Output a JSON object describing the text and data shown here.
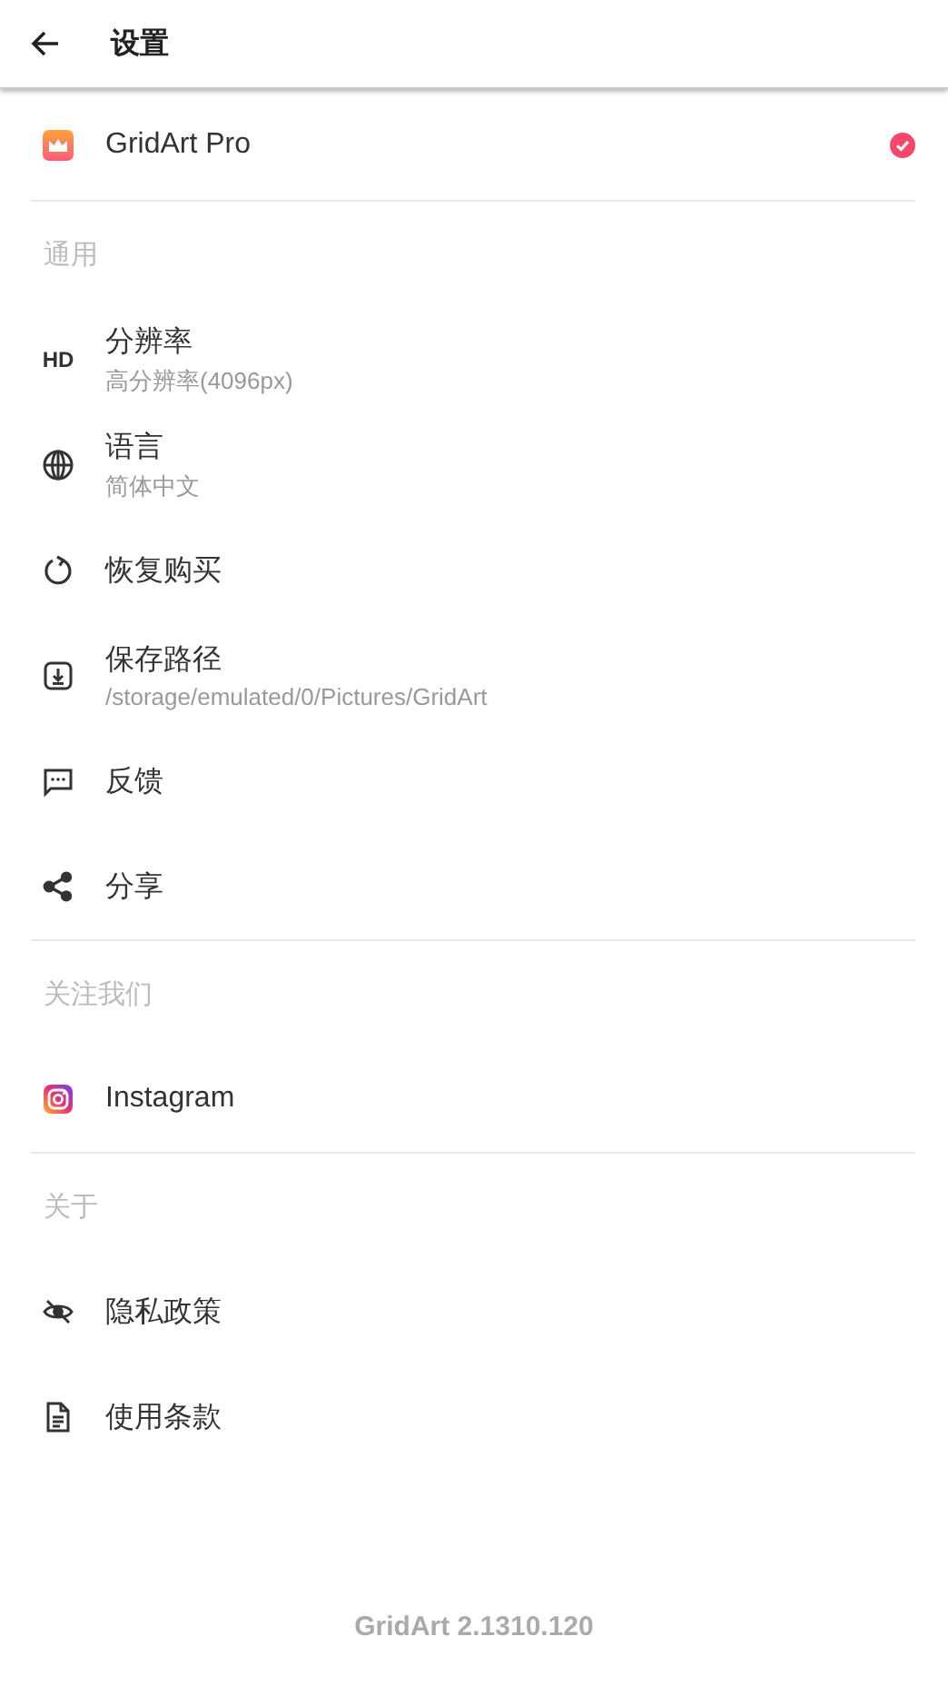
{
  "app_bar": {
    "title": "设置"
  },
  "pro": {
    "label": "GridArt Pro",
    "checked": true
  },
  "sections": [
    {
      "title": "通用",
      "items": [
        {
          "kind": "hd",
          "icon_text": "HD",
          "label": "分辨率",
          "subtitle": "高分辨率(4096px)"
        },
        {
          "kind": "globe",
          "label": "语言",
          "subtitle": "简体中文"
        },
        {
          "kind": "restore",
          "label": "恢复购买"
        },
        {
          "kind": "download",
          "label": "保存路径",
          "subtitle": "/storage/emulated/0/Pictures/GridArt"
        },
        {
          "kind": "feedback",
          "label": "反馈"
        },
        {
          "kind": "share",
          "label": "分享"
        }
      ]
    },
    {
      "title": "关注我们",
      "items": [
        {
          "kind": "instagram",
          "label": "Instagram"
        }
      ]
    },
    {
      "title": "关于",
      "items": [
        {
          "kind": "privacy",
          "label": "隐私政策"
        },
        {
          "kind": "terms",
          "label": "使用条款"
        }
      ]
    }
  ],
  "version": "GridArt 2.1310.120"
}
